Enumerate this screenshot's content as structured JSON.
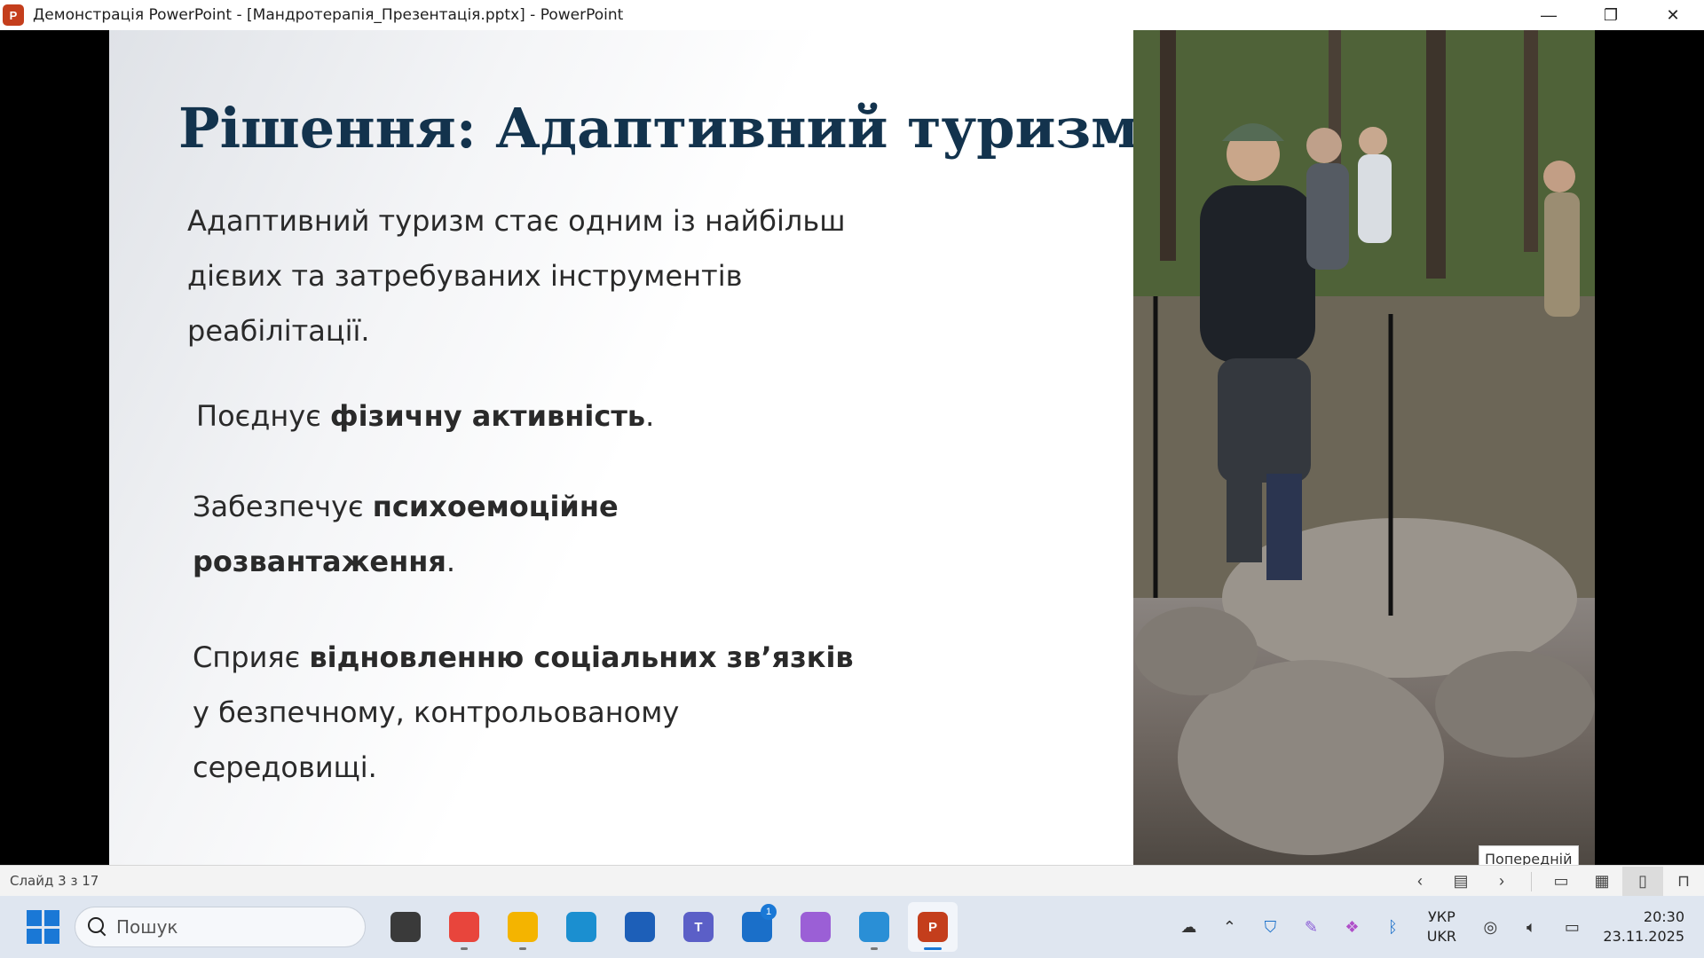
{
  "window": {
    "app_icon_letter": "P",
    "title": "Демонстрація PowerPoint - [Мандротерапія_Презентація.pptx] - PowerPoint",
    "minimize": "—",
    "restore": "❐",
    "close": "✕"
  },
  "slide": {
    "title": "Рішення: Адаптивний туризм",
    "p1": "Адаптивний туризм стає одним із найбільш дієвих та затребуваних інструментів реабілітації.",
    "p2_plain": "Поєднує ",
    "p2_bold": "фізичну активність",
    "p2_end": ".",
    "p3_plain": "Забезпечує ",
    "p3_bold": "психоемоційне розвантаження",
    "p3_end": ".",
    "p4_plain": "Сприяє ",
    "p4_bold": "відновленню соціальних зв’язків",
    "p4_end": " у безпечному, контрольованому середовищі.",
    "photo_icon": "hiking-photo",
    "tooltip": "Попередній"
  },
  "statusbar": {
    "slide_counter": "Слайд 3 з 17",
    "prev_icon": "‹",
    "menu_icon": "▤",
    "next_icon": "›",
    "normal_view_icon": "▭",
    "sorter_view_icon": "▦",
    "reading_view_icon": "▯",
    "slideshow_icon": "⊓"
  },
  "taskbar": {
    "search_placeholder": "Пошук",
    "apps": [
      {
        "name": "task-view",
        "glyph": "",
        "color": "#3a3a3a"
      },
      {
        "name": "chrome",
        "glyph": "",
        "color": "#e8453c"
      },
      {
        "name": "file-explorer",
        "glyph": "",
        "color": "#f4b400"
      },
      {
        "name": "edge",
        "glyph": "",
        "color": "#1b8fd0"
      },
      {
        "name": "store",
        "glyph": "",
        "color": "#1d5fb8"
      },
      {
        "name": "teams",
        "glyph": "T",
        "color": "#5b5fc7"
      },
      {
        "name": "outlook-like",
        "glyph": "",
        "color": "#1a6fc9",
        "badge": "1"
      },
      {
        "name": "copilot",
        "glyph": "",
        "color": "#9b5fd6"
      },
      {
        "name": "photos",
        "glyph": "",
        "color": "#2a8fd6"
      },
      {
        "name": "powerpoint",
        "glyph": "P",
        "color": "#c43e1c"
      }
    ],
    "lang_top": "УКР",
    "lang_bottom": "UKR",
    "time": "20:30",
    "date": "23.11.2025"
  }
}
